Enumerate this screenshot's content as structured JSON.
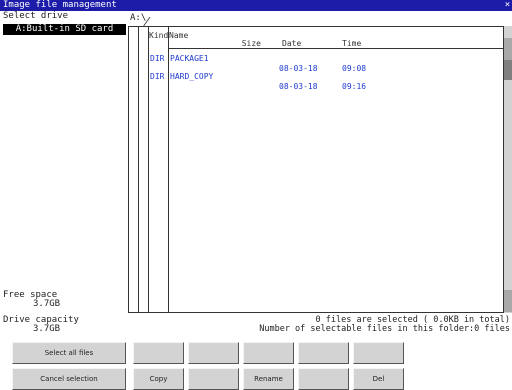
{
  "window": {
    "title": "Image file management",
    "close_label": "×"
  },
  "left": {
    "select_drive_label": "Select drive",
    "drive": "A:Built-in SD card",
    "free_space_label": "Free space",
    "free_space_value": "3.7GB",
    "capacity_label": "Drive capacity",
    "capacity_value": "3.7GB"
  },
  "path": "A:\\",
  "list": {
    "headers": {
      "kind": "Kind",
      "name": "Name",
      "size": "Size",
      "date": "Date",
      "time": "Time"
    },
    "rows": [
      {
        "kind": "DIR",
        "name": "PACKAGE1",
        "date": "08-03-18",
        "time": "09:08"
      },
      {
        "kind": "DIR",
        "name": "HARD_COPY",
        "date": "08-03-18",
        "time": "09:16"
      }
    ]
  },
  "status": {
    "selected": "0 files are selected (   0.0KB in total)",
    "selectable": "Number of selectable files in this folder:0 files"
  },
  "buttons": {
    "select_all": "Select all files",
    "cancel_selection": "Cancel selection",
    "copy": "Copy",
    "rename": "Rename",
    "del": "Del"
  },
  "colors": {
    "titlebar": "#1c1ca8",
    "list_text": "#1f3bd0"
  }
}
